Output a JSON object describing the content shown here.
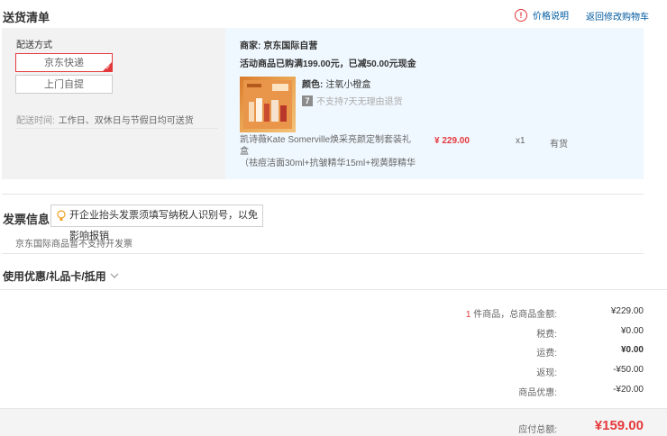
{
  "header": {
    "title": "送货清单",
    "price_info_icon": "!",
    "price_info_label": "价格说明",
    "back_to_cart_label": "返回修改购物车"
  },
  "delivery": {
    "section_label": "配送方式",
    "options": [
      {
        "label": "京东快递",
        "selected": true
      },
      {
        "label": "上门自提",
        "selected": false
      }
    ],
    "time_label": "配送时间:",
    "time_value": "工作日、双休日与节假日均可送货"
  },
  "shop": {
    "seller_label": "商家:",
    "seller_name": "京东国际自营",
    "promo_text": "活动商品已购满199.00元，已减50.00元现金",
    "product": {
      "color_label": "颜色:",
      "color_value": "注氧小橙盒",
      "return_badge": "7",
      "return_policy": "不支持7天无理由退货",
      "name_line1": "凯诗薇Kate Somerville焕采亮颜定制套装礼盒",
      "name_line2": "（祛痘洁面30ml+抗皱精华15ml+视黄醇精华",
      "price": "¥ 229.00",
      "quantity": "x1",
      "stock": "有货",
      "image_icon": "gift-box-product-image"
    }
  },
  "invoice": {
    "title": "发票信息",
    "tip": "开企业抬头发票须填写纳税人识别号，以免影响报销",
    "note": "京东国际商品暂不支持开发票"
  },
  "coupon": {
    "title": "使用优惠/礼品卡/抵用"
  },
  "summary": {
    "item_count": "1",
    "item_count_label": "件商品，总商品金额:",
    "rows": [
      {
        "label": "税费:",
        "value": "¥0.00"
      },
      {
        "label": "运费:",
        "value": "¥0.00"
      },
      {
        "label": "返现:",
        "value": "-¥50.00"
      },
      {
        "label": "商品优惠:",
        "value": "-¥20.00"
      }
    ],
    "subtotal_value": "¥229.00",
    "total_label": "应付总额:",
    "total_value": "¥159.00"
  },
  "colors": {
    "accent": "#e4393c",
    "link": "#005aa0",
    "panel_gray": "#f2f2f2",
    "panel_blue": "#f0f8ff"
  }
}
